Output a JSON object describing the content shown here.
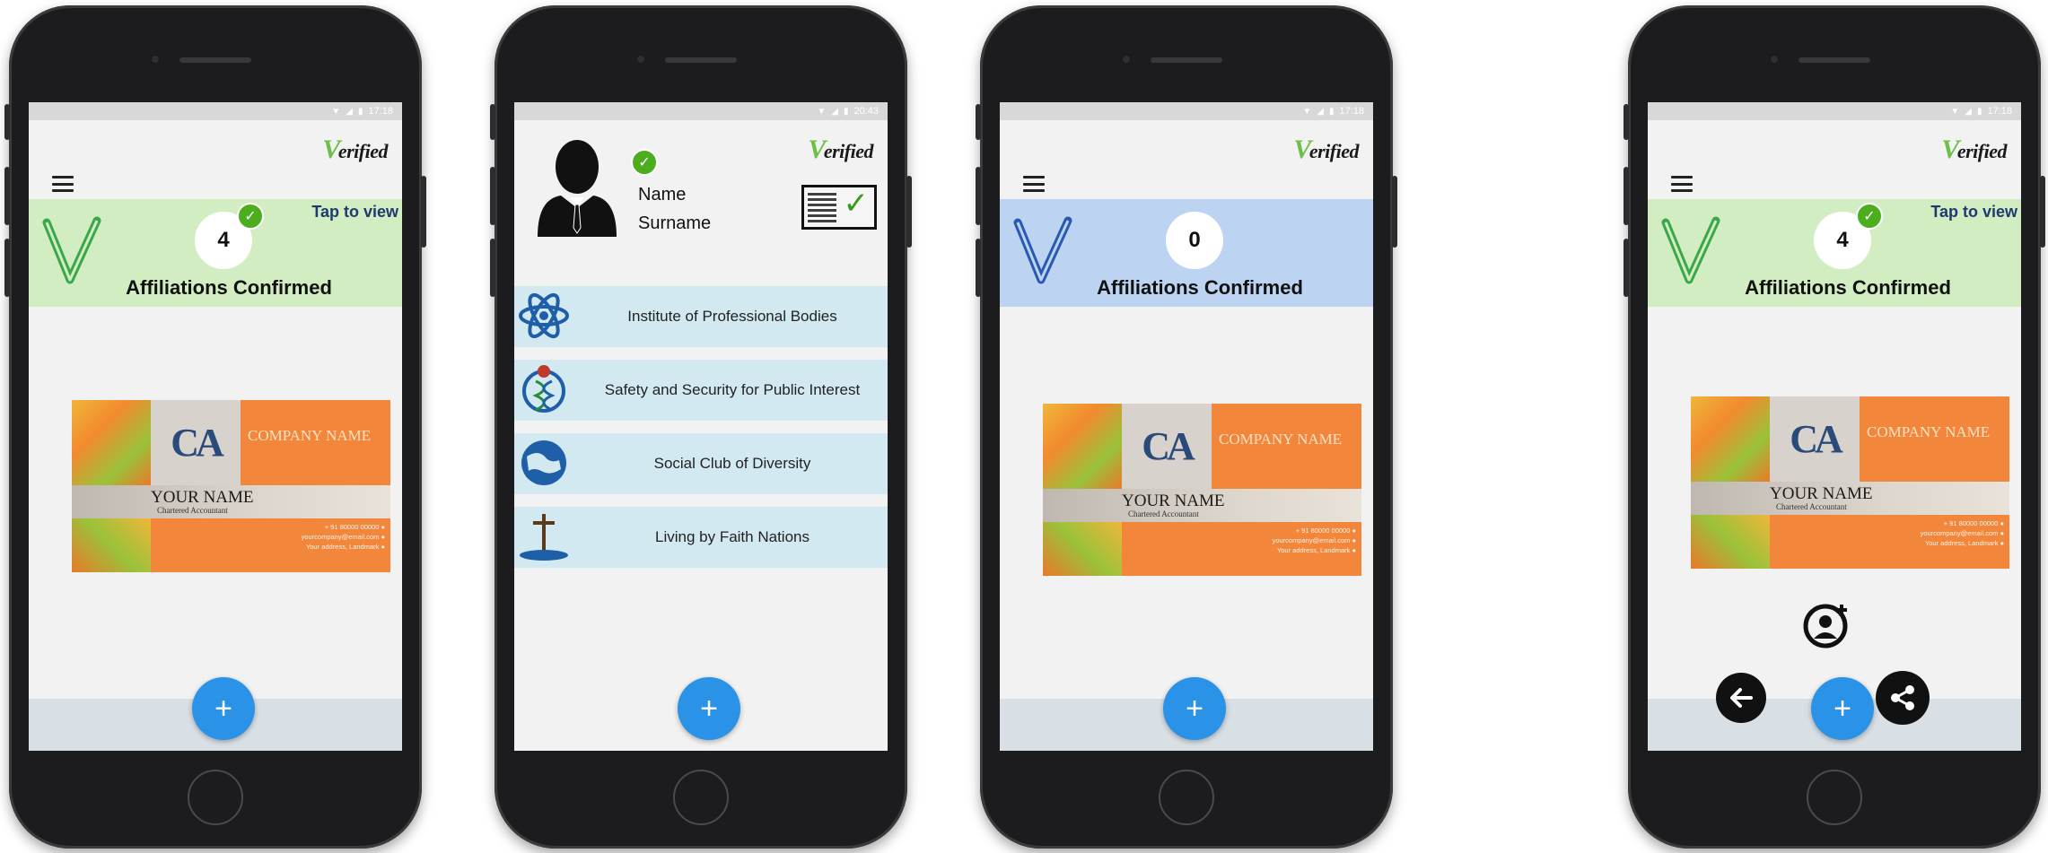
{
  "status_time_1": "17:18",
  "status_time_2": "20:43",
  "status_time_3": "17:18",
  "status_time_4": "17:18",
  "logo": {
    "initial": "V",
    "rest": "erified"
  },
  "banner": {
    "count_verified": "4",
    "count_unverified": "0",
    "tap_to_view": "Tap to view",
    "label": "Affiliations Confirmed"
  },
  "card": {
    "company": "COMPANY NAME",
    "your_name": "YOUR NAME",
    "title": "Chartered Accountant",
    "phone": "+ 91 80000 00000 ●",
    "email": "yourcompany@email.com ●",
    "address": "Your address, Landmark ●"
  },
  "profile": {
    "name": "Name",
    "surname": "Surname"
  },
  "organizations": [
    {
      "label": "Institute of Professional Bodies",
      "icon": "atom-icon"
    },
    {
      "label": "Safety and Security for Public Interest",
      "icon": "dna-icon"
    },
    {
      "label": "Social Club of Diversity",
      "icon": "globe-icon"
    },
    {
      "label": "Living by Faith Nations",
      "icon": "cross-icon"
    }
  ],
  "fab_label": "+",
  "colors": {
    "accent": "#2a93e8",
    "green_banner": "#d3edc3",
    "blue_banner": "#bcd4f2",
    "check": "#4cae1e"
  }
}
